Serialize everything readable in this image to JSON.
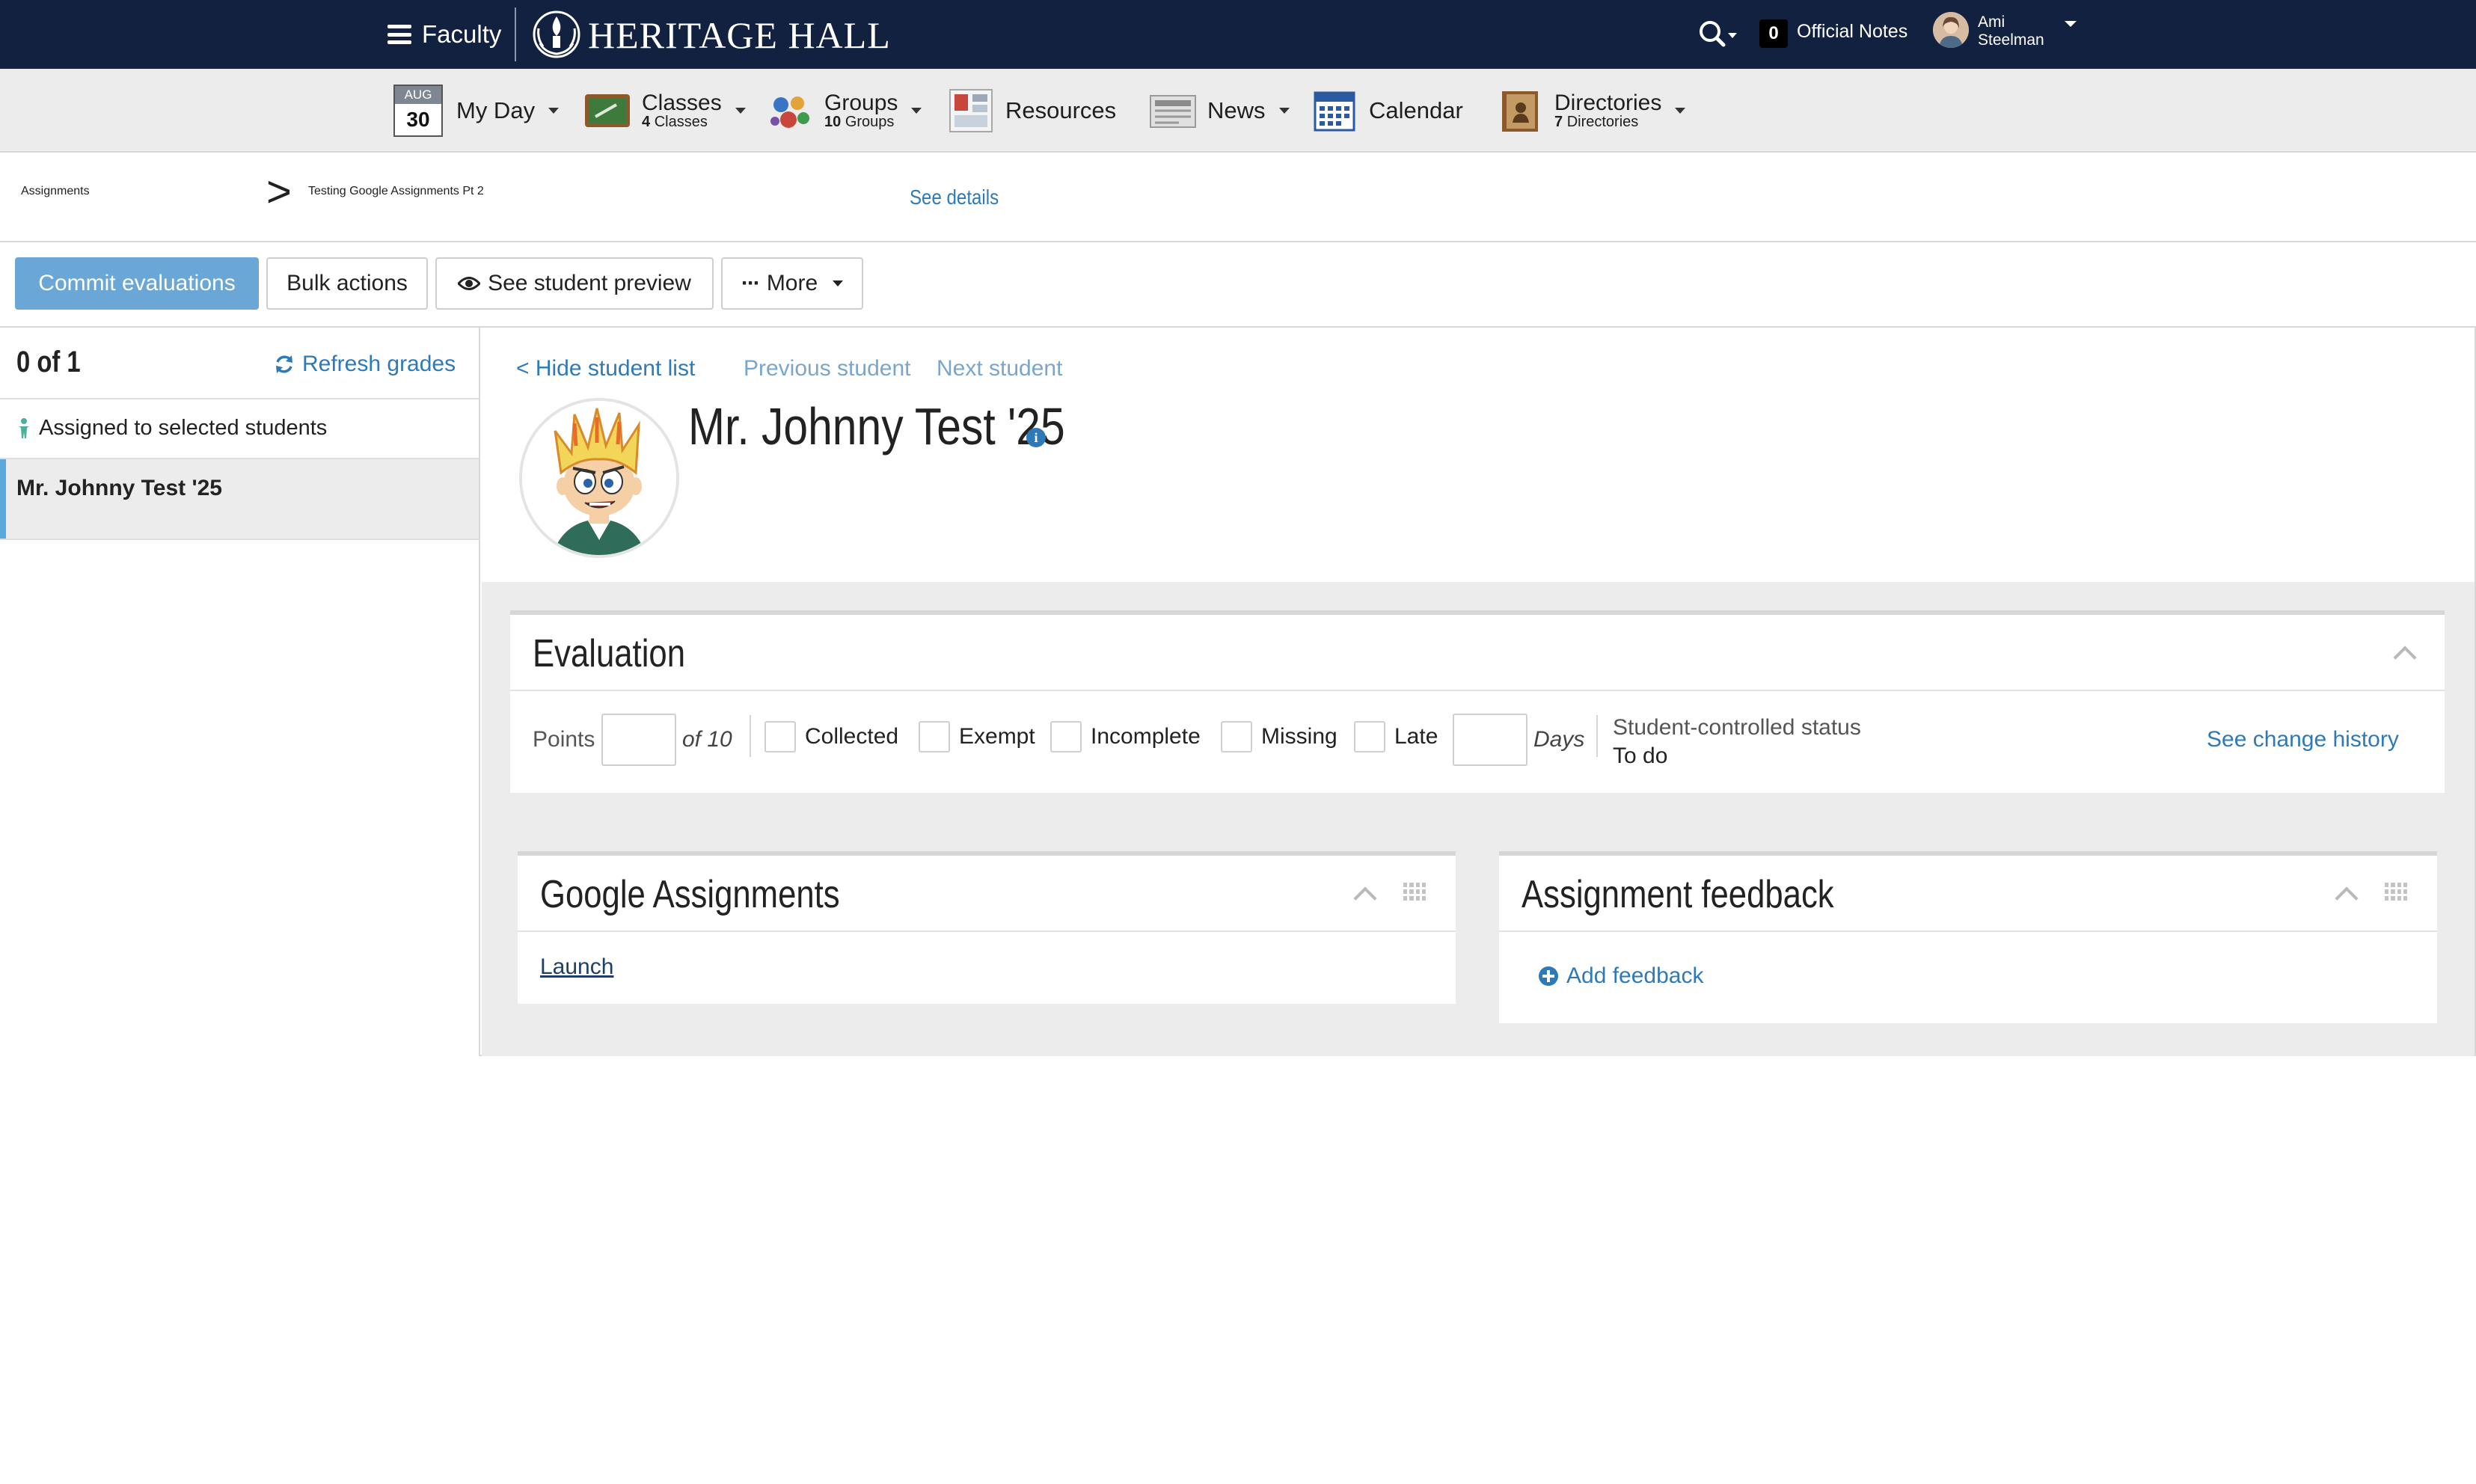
{
  "topbar": {
    "menu_label": "Faculty",
    "brand": "HERITAGE HALL",
    "notes_count": "0",
    "notes_label": "Official Notes",
    "user_first": "Ami",
    "user_last": "Steelman"
  },
  "nav": {
    "myday": {
      "month": "AUG",
      "day": "30",
      "label": "My Day"
    },
    "classes": {
      "label": "Classes",
      "count": "4",
      "sub": "Classes"
    },
    "groups": {
      "label": "Groups",
      "count": "10",
      "sub": "Groups"
    },
    "resources": {
      "label": "Resources"
    },
    "news": {
      "label": "News"
    },
    "calendar": {
      "label": "Calendar"
    },
    "directories": {
      "label": "Directories",
      "count": "7",
      "sub": "Directories"
    }
  },
  "header": {
    "root": "Assignments",
    "separator": ">",
    "current": "Testing Google Assignments Pt 2",
    "see_details": "See details"
  },
  "toolbar": {
    "commit": "Commit evaluations",
    "bulk": "Bulk actions",
    "preview": "See student preview",
    "more": "More"
  },
  "student_list": {
    "count": "0 of 1",
    "refresh": "Refresh grades",
    "assigned": "Assigned to selected students",
    "students": [
      "Mr. Johnny Test '25"
    ]
  },
  "student": {
    "hide_list": "< Hide student list",
    "previous": "Previous student",
    "next": "Next student",
    "name": "Mr. Johnny Test '25"
  },
  "evaluation": {
    "title": "Evaluation",
    "points_label": "Points",
    "points_value": "",
    "of_label": "of 10",
    "collected": "Collected",
    "exempt": "Exempt",
    "incomplete": "Incomplete",
    "missing": "Missing",
    "late": "Late",
    "days_label": "Days",
    "status_label": "Student-controlled status",
    "status_value": "To do",
    "change_history": "See change history"
  },
  "google_panel": {
    "title": "Google Assignments",
    "launch": "Launch"
  },
  "feedback_panel": {
    "title": "Assignment feedback",
    "add": "Add feedback"
  },
  "colors": {
    "navy": "#12213f",
    "link": "#2e7ab8",
    "primary_btn": "#6aa6d6",
    "selected_bar": "#5aa8dc"
  }
}
